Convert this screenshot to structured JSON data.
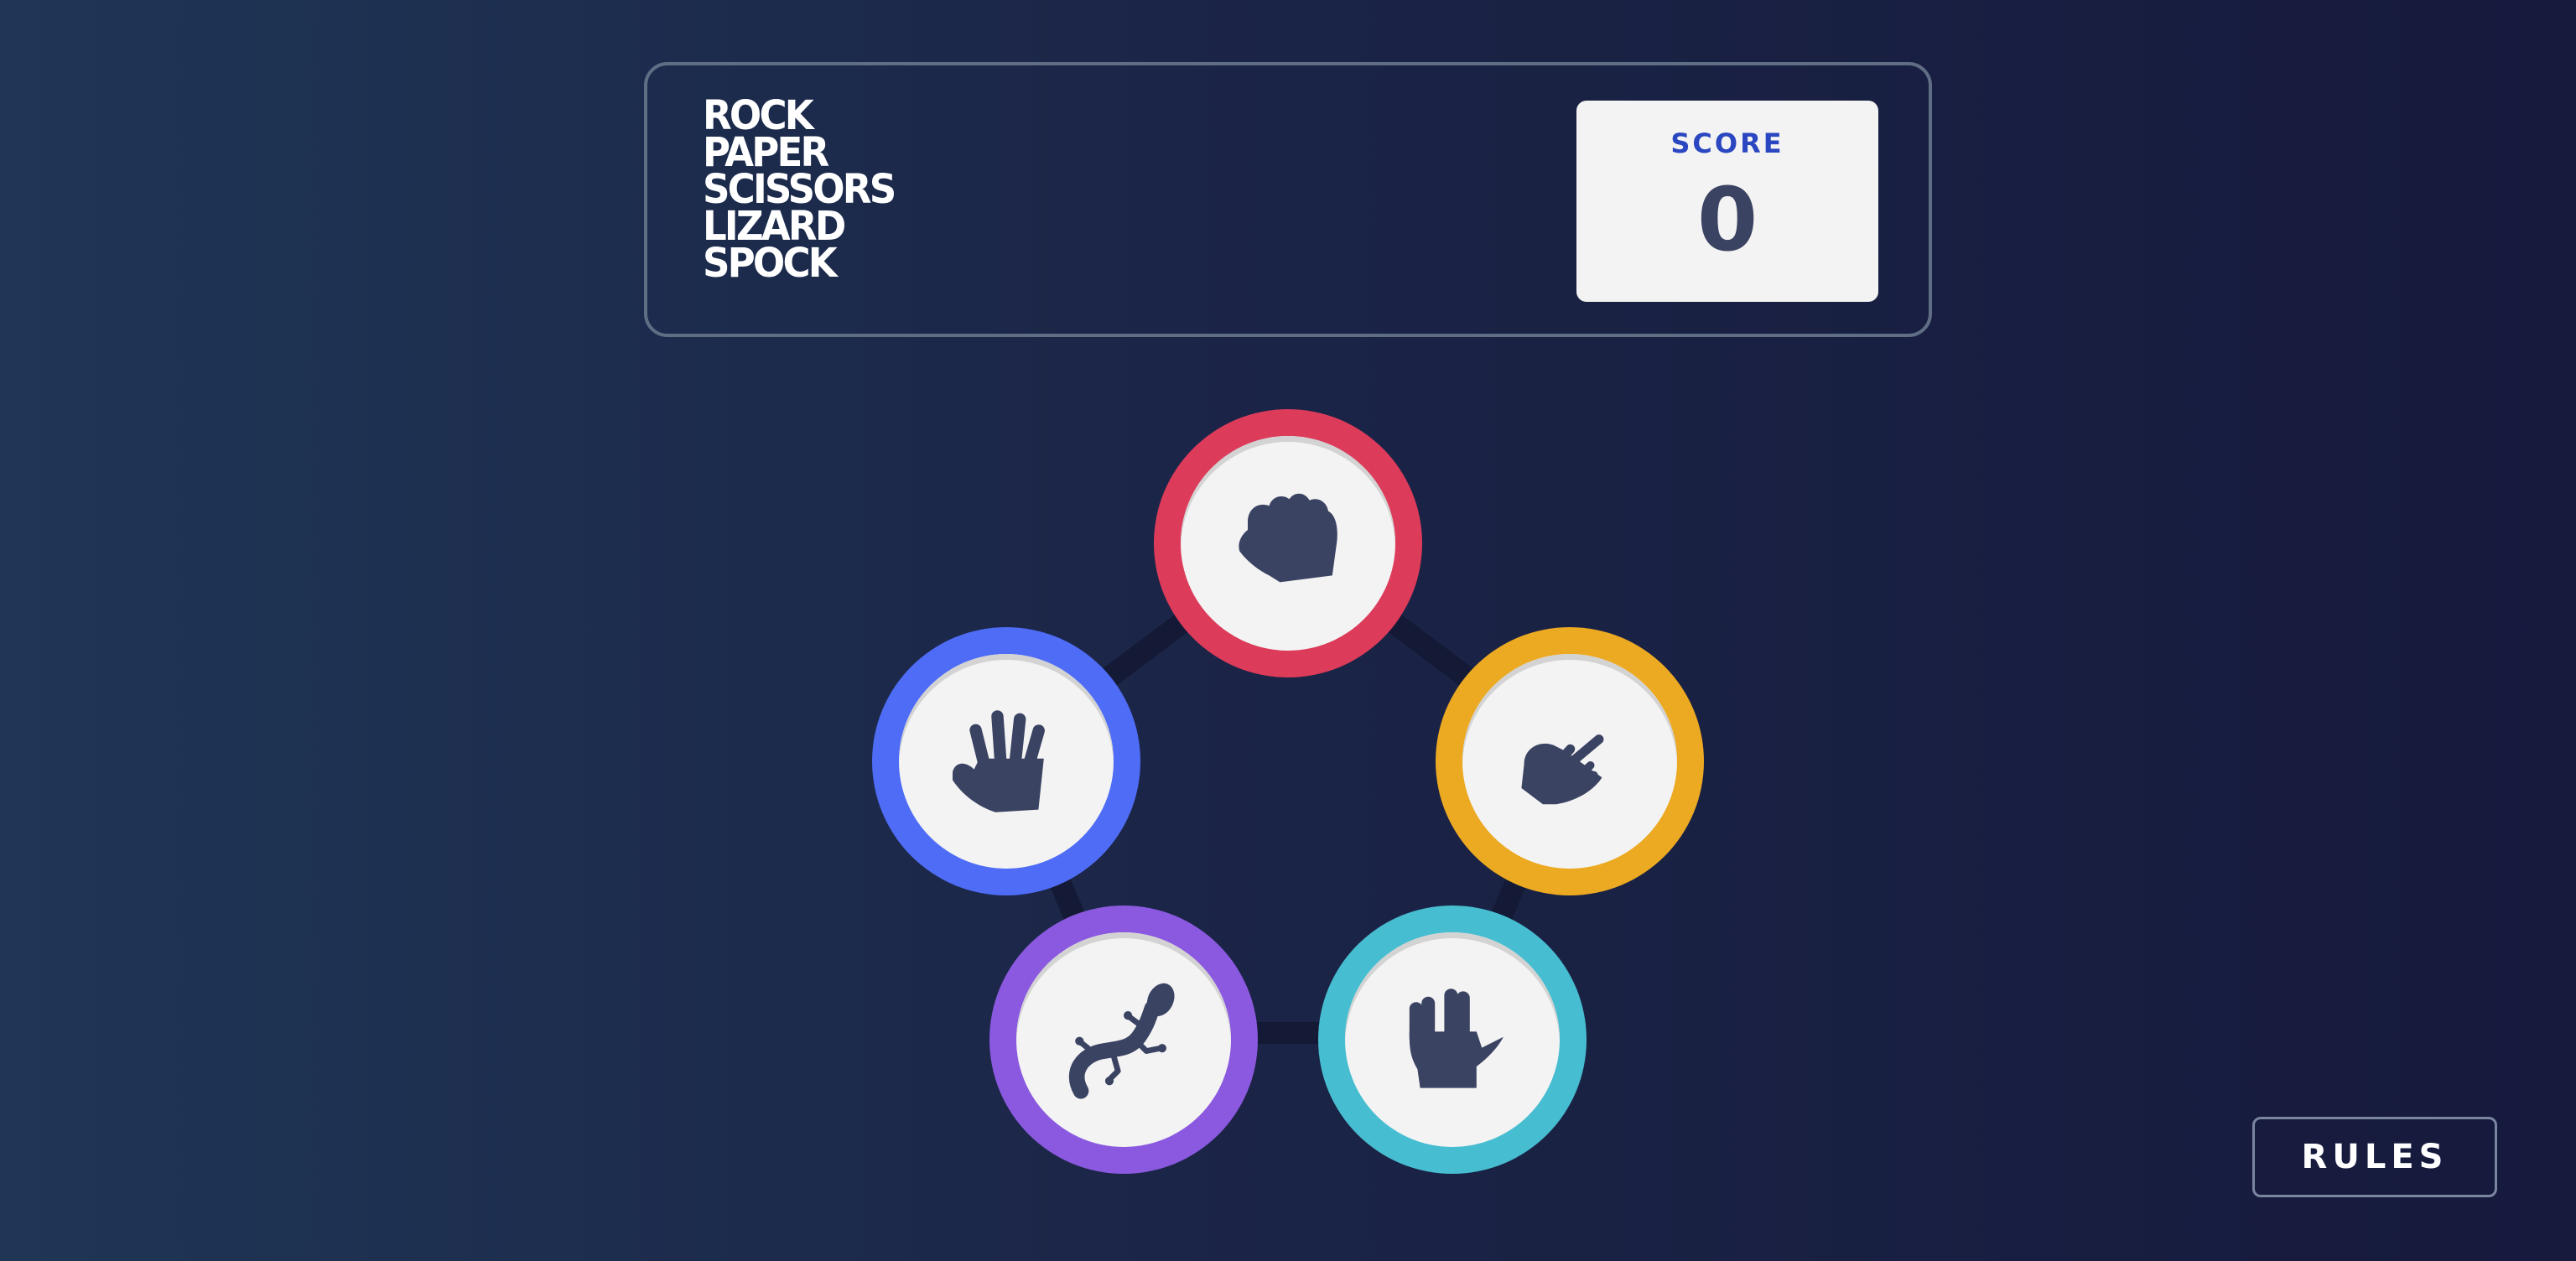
{
  "header": {
    "title_lines": [
      "ROCK",
      "PAPER",
      "SCISSORS",
      "LIZARD",
      "SPOCK"
    ],
    "score": {
      "label": "SCORE",
      "value": "0"
    }
  },
  "tokens": [
    {
      "name": "rock",
      "icon": "rock-fist-icon",
      "color": "#dc3b5a"
    },
    {
      "name": "scissors",
      "icon": "scissors-hand-icon",
      "color": "#eca922"
    },
    {
      "name": "spock",
      "icon": "spock-hand-icon",
      "color": "#47bdd1"
    },
    {
      "name": "lizard",
      "icon": "lizard-icon",
      "color": "#8b59e0"
    },
    {
      "name": "paper",
      "icon": "paper-hand-icon",
      "color": "#4e6cf5"
    }
  ],
  "rules_button": {
    "label": "RULES"
  },
  "colors": {
    "background_start": "#1f3656",
    "background_end": "#161a3d",
    "icon": "#3b4363",
    "score_label": "#2a46c0"
  }
}
